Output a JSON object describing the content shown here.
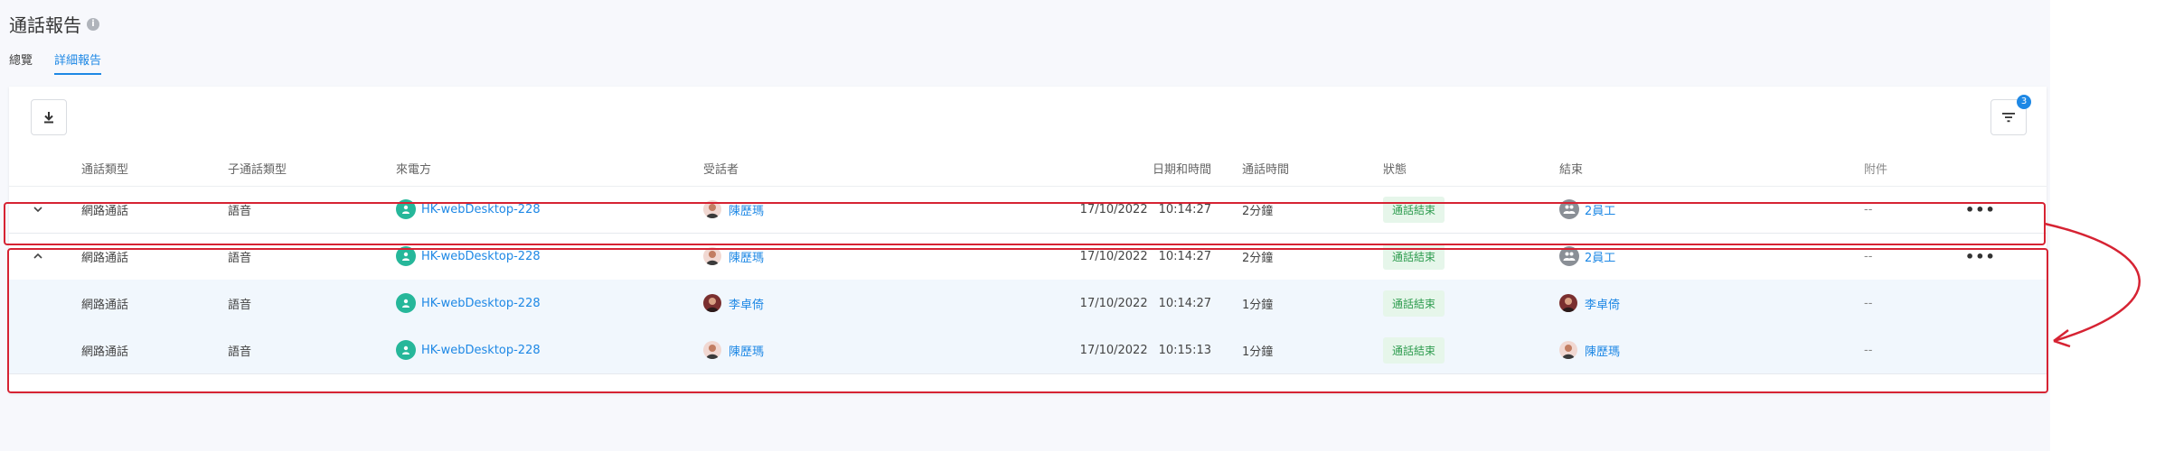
{
  "page": {
    "title": "通話報告",
    "tabs": [
      {
        "label": "總覽",
        "active": false
      },
      {
        "label": "詳細報告",
        "active": true
      }
    ]
  },
  "toolbar": {
    "download_icon": "download-icon",
    "filter_icon": "filter-icon",
    "filter_count": "3"
  },
  "table": {
    "headers": {
      "type": "通話類型",
      "sub_type": "子通話類型",
      "caller": "來電方",
      "callee": "受話者",
      "datetime": "日期和時間",
      "duration": "通話時間",
      "status": "狀態",
      "result": "結束",
      "attachment": "附件"
    },
    "rows": [
      {
        "type": "網路通話",
        "sub_type": "語音",
        "caller": "HK-webDesktop-228",
        "callee": "陳歷瑪",
        "date": "17/10/2022",
        "time": "10:14:27",
        "duration": "2分鐘",
        "status": "通話結束",
        "result": "2員工",
        "attachment": "--",
        "more": "•••"
      },
      {
        "type": "網路通話",
        "sub_type": "語音",
        "caller": "HK-webDesktop-228",
        "callee": "陳歷瑪",
        "date": "17/10/2022",
        "time": "10:14:27",
        "duration": "2分鐘",
        "status": "通話結束",
        "result": "2員工",
        "attachment": "--",
        "more": "•••"
      },
      {
        "type": "網路通話",
        "sub_type": "語音",
        "caller": "HK-webDesktop-228",
        "callee": "李卓倚",
        "date": "17/10/2022",
        "time": "10:14:27",
        "duration": "1分鐘",
        "status": "通話結束",
        "result": "李卓倚",
        "attachment": "--"
      },
      {
        "type": "網路通話",
        "sub_type": "語音",
        "caller": "HK-webDesktop-228",
        "callee": "陳歷瑪",
        "date": "17/10/2022",
        "time": "10:15:13",
        "duration": "1分鐘",
        "status": "通話結束",
        "result": "陳歷瑪",
        "attachment": "--"
      }
    ]
  },
  "colors": {
    "accent": "#1e88e5",
    "status_bg": "#e6f6ea",
    "status_text": "#2e9c4f",
    "annotation": "#d62333"
  }
}
